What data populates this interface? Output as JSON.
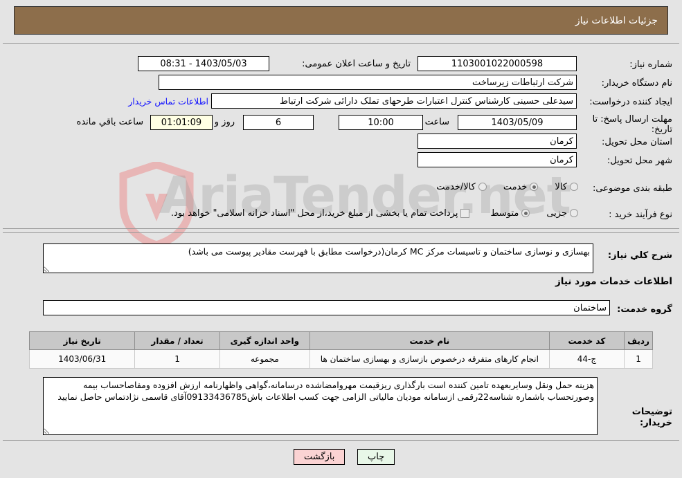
{
  "header": {
    "title": "جزئیات اطلاعات نیاز"
  },
  "watermark": {
    "text": "AriaTender.net",
    "shield_color": "#e8b6b6",
    "text_color": "#969696"
  },
  "form": {
    "need_number": {
      "label": "شماره نیاز:",
      "value": "1103001022000598"
    },
    "public_announce": {
      "label": "تاریخ و ساعت اعلان عمومی:",
      "value": "1403/05/03 - 08:31"
    },
    "buyer_org": {
      "label": "نام دستگاه خریدار:",
      "value": "شرکت ارتباطات زیرساخت"
    },
    "creator": {
      "label": "ایجاد کننده درخواست:",
      "value": "سیدعلی حسینی کارشناس کنترل اعتبارات طرحهای تملک دارائی شرکت ارتباط",
      "contact_link": "اطلاعات تماس خریدار"
    },
    "deadline": {
      "label": "مهلت ارسال پاسخ: تا تاریخ:",
      "date": "1403/05/09",
      "time_label": "ساعت",
      "time": "10:00",
      "days": "6",
      "days_label": "روز و",
      "countdown": "01:01:09",
      "remaining_label": "ساعت باقي مانده"
    },
    "province": {
      "label": "استان محل تحویل:",
      "value": "کرمان"
    },
    "city": {
      "label": "شهر محل تحویل:",
      "value": "کرمان"
    },
    "category": {
      "label": "طبقه بندی موضوعی:",
      "options": [
        "کالا",
        "خدمت",
        "کالا/خدمت"
      ],
      "selected": "خدمت"
    },
    "purchase_type": {
      "label": "نوع فرآیند خرید :",
      "options": [
        "جزیی",
        "متوسط"
      ],
      "selected": "متوسط",
      "checkbox_label": "پرداخت تمام یا بخشی از مبلغ خرید،از محل \"اسناد خزانه اسلامی\" خواهد بود.",
      "checkbox_checked": false
    },
    "general_desc": {
      "label": "شرح کلي نياز:",
      "value": "بهسازی و نوسازی ساختمان و تاسیسات مرکز MC کرمان(درخواست مطابق با فهرست مقادیر پیوست می باشد)"
    },
    "services_section_title": "اطلاعات خدمات مورد نیاز",
    "service_group": {
      "label": "گروه خدمت:",
      "value": "ساختمان"
    },
    "buyer_notes": {
      "label": "توضیحات خریدار:",
      "value": "هزینه حمل ونقل وسایربعهده تامین کننده است بارگذاری ریزقیمت مهروامضاشده درسامانه،گواهی واظهارنامه ارزش افزوده ومفاصاحساب بیمه وصورتحساب باشماره شناسه22رقمی ازسامانه مودیان مالیاتی الزامی جهت کسب اطلاعات باش09133436785آقای قاسمی نژادتماس حاصل نمایید"
    }
  },
  "table": {
    "columns": [
      "ردیف",
      "کد خدمت",
      "نام خدمت",
      "واحد اندازه گیری",
      "تعداد / مقدار",
      "تاریخ نیاز"
    ],
    "rows": [
      {
        "row_no": "1",
        "service_code": "ج-44",
        "service_name": "انجام کارهای متفرقه درخصوص بازسازی و بهسازی ساختمان ها",
        "unit": "مجموعه",
        "quantity": "1",
        "need_date": "1403/06/31"
      }
    ]
  },
  "buttons": {
    "print": "چاپ",
    "back": "بازگشت"
  }
}
